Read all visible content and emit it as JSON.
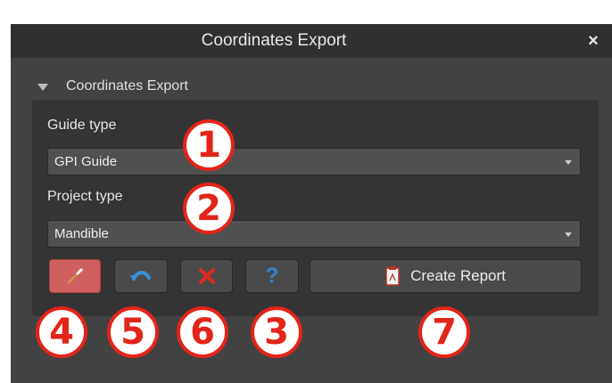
{
  "window": {
    "title": "Coordinates Export",
    "close_symbol": "×"
  },
  "section": {
    "label": "Coordinates Export",
    "expanded": true
  },
  "guide_type": {
    "label": "Guide type",
    "value": "GPI Guide"
  },
  "project_type": {
    "label": "Project type",
    "value": "Mandible"
  },
  "toolbar": {
    "pick_icon": "picker-wand-icon",
    "undo_icon": "undo-icon",
    "delete_icon": "delete-x-icon",
    "help_label": "?",
    "report_icon": "pdf-document-icon",
    "report_label": "Create Report"
  },
  "callouts": [
    "1",
    "2",
    "3",
    "4",
    "5",
    "6",
    "7"
  ],
  "colors": {
    "window_bg": "#424242",
    "titlebar_bg": "#303030",
    "panel_bg": "#343434",
    "active_button": "#d06060",
    "callout_red": "#e32418",
    "help_blue": "#2f86d6"
  }
}
